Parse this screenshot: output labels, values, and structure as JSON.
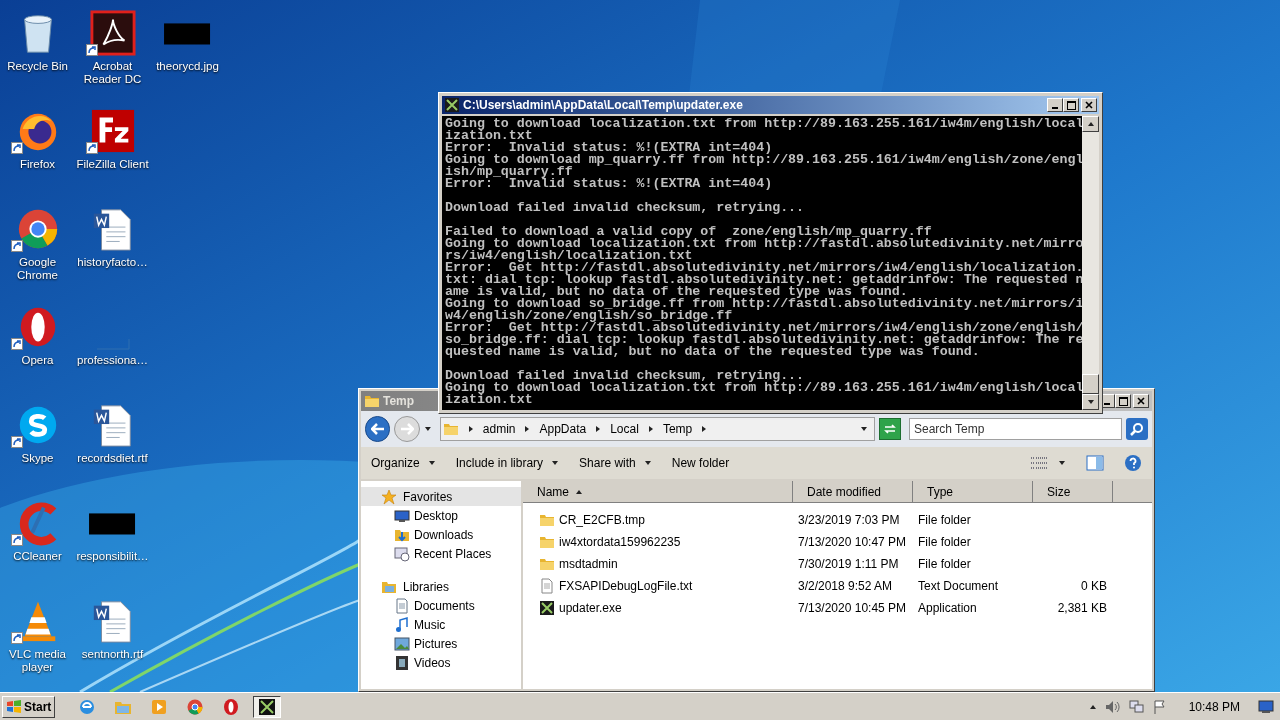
{
  "desktop": {
    "icons": [
      {
        "label": "Recycle Bin",
        "kind": "recycle",
        "shortcut": false
      },
      {
        "label": "Firefox",
        "kind": "firefox",
        "shortcut": true
      },
      {
        "label": "Google Chrome",
        "kind": "chrome",
        "shortcut": true
      },
      {
        "label": "Opera",
        "kind": "opera",
        "shortcut": true
      },
      {
        "label": "Skype",
        "kind": "skype",
        "shortcut": true
      },
      {
        "label": "CCleaner",
        "kind": "ccleaner",
        "shortcut": true
      },
      {
        "label": "VLC media player",
        "kind": "vlc",
        "shortcut": true
      },
      {
        "label": "Acrobat Reader DC",
        "kind": "acrobat",
        "shortcut": true
      },
      {
        "label": "FileZilla Client",
        "kind": "filezilla",
        "shortcut": true
      },
      {
        "label": "historyfacto…",
        "kind": "word",
        "shortcut": false
      },
      {
        "label": "professiona…",
        "kind": "blank",
        "shortcut": false
      },
      {
        "label": "recordsdiet.rtf",
        "kind": "word",
        "shortcut": false
      },
      {
        "label": "responsibilit…",
        "kind": "dark",
        "shortcut": false
      },
      {
        "label": "sentnorth.rtf",
        "kind": "word",
        "shortcut": false
      },
      {
        "label": "theorycd.jpg",
        "kind": "dark",
        "shortcut": false
      }
    ]
  },
  "console": {
    "title": "C:\\Users\\admin\\AppData\\Local\\Temp\\updater.exe",
    "blocks": [
      [
        "Going to download localization.txt from http://89.163.255.161/iw4m/english/local",
        "ization.txt",
        "Error:  Invalid status: %!(EXTRA int=404)",
        "Going to download mp_quarry.ff from http://89.163.255.161/iw4m/english/zone/engl",
        "ish/mp_quarry.ff",
        "Error:  Invalid status: %!(EXTRA int=404)"
      ],
      [
        "Download failed invalid checksum, retrying..."
      ],
      [
        "Failed to download a valid copy of  zone/english/mp_quarry.ff",
        "Going to download localization.txt from http://fastdl.absolutedivinity.net/mirro",
        "rs/iw4/english/localization.txt",
        "Error:  Get http://fastdl.absolutedivinity.net/mirrors/iw4/english/localization.",
        "txt: dial tcp: lookup fastdl.absolutedivinity.net: getaddrinfow: The requested n",
        "ame is valid, but no data of the requested type was found.",
        "Going to download so_bridge.ff from http://fastdl.absolutedivinity.net/mirrors/i",
        "w4/english/zone/english/so_bridge.ff",
        "Error:  Get http://fastdl.absolutedivinity.net/mirrors/iw4/english/zone/english/",
        "so_bridge.ff: dial tcp: lookup fastdl.absolutedivinity.net: getaddrinfow: The re",
        "quested name is valid, but no data of the requested type was found."
      ],
      [
        "Download failed invalid checksum, retrying...",
        "Going to download localization.txt from http://89.163.255.161/iw4m/english/local",
        "ization.txt"
      ]
    ]
  },
  "explorer": {
    "title": "Temp",
    "breadcrumb": [
      "admin",
      "AppData",
      "Local",
      "Temp"
    ],
    "search": {
      "placeholder": "Search Temp"
    },
    "toolbar": [
      {
        "label": "Organize",
        "menu": true
      },
      {
        "label": "Include in library",
        "menu": true
      },
      {
        "label": "Share with",
        "menu": true
      },
      {
        "label": "New folder",
        "menu": false
      }
    ],
    "nav": [
      {
        "label": "Favorites",
        "kind": "star",
        "selected": true,
        "children": [
          {
            "label": "Desktop",
            "kind": "desktop",
            "selected": false
          },
          {
            "label": "Downloads",
            "kind": "downloads",
            "selected": false
          },
          {
            "label": "Recent Places",
            "kind": "recent",
            "selected": false
          }
        ]
      },
      {
        "label": "Libraries",
        "kind": "library",
        "selected": false,
        "children": [
          {
            "label": "Documents",
            "kind": "documents",
            "selected": false
          },
          {
            "label": "Music",
            "kind": "music",
            "selected": false
          },
          {
            "label": "Pictures",
            "kind": "pictures",
            "selected": false
          },
          {
            "label": "Videos",
            "kind": "videos",
            "selected": false
          }
        ]
      }
    ],
    "columns": [
      {
        "label": "Name",
        "sorted": true
      },
      {
        "label": "Date modified",
        "sorted": false
      },
      {
        "label": "Type",
        "sorted": false
      },
      {
        "label": "Size",
        "sorted": false
      }
    ],
    "rows": [
      {
        "name": "CR_E2CFB.tmp",
        "kind": "folder",
        "date": "3/23/2019 7:03 PM",
        "type": "File folder"
      },
      {
        "name": "iw4xtordata159962235",
        "kind": "folder",
        "date": "7/13/2020 10:47 PM",
        "type": "File folder"
      },
      {
        "name": "msdtadmin",
        "kind": "folder",
        "date": "7/30/2019 1:11 PM",
        "type": "File folder"
      },
      {
        "name": "FXSAPIDebugLogFile.txt",
        "kind": "text",
        "date": "3/2/2018 9:52 AM",
        "type": "Text Document",
        "size": "0 KB"
      },
      {
        "name": "updater.exe",
        "kind": "exe",
        "date": "7/13/2020 10:45 PM",
        "type": "Application",
        "size": "2,381 KB"
      }
    ]
  },
  "taskbar": {
    "start": "Start",
    "items": [
      {
        "kind": "ie",
        "active": false
      },
      {
        "kind": "explorer",
        "active": false
      },
      {
        "kind": "media",
        "active": false
      },
      {
        "kind": "chrome",
        "active": false
      },
      {
        "kind": "opera",
        "active": false
      },
      {
        "kind": "exe",
        "active": true
      }
    ],
    "clock": "10:48 PM"
  }
}
